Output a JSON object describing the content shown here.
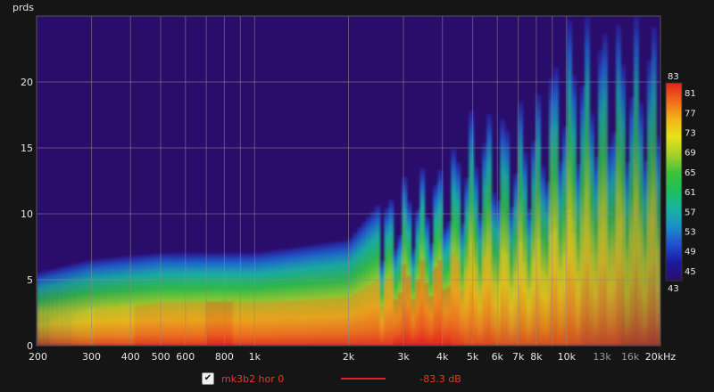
{
  "chart_data": {
    "type": "heatmap",
    "ylabel": "prds",
    "xlabel": "",
    "x_unit_label": "kHz",
    "x_scale": "log",
    "xlim": [
      200,
      20000
    ],
    "ylim": [
      0,
      25
    ],
    "x_ticks": [
      {
        "v": 200,
        "label": "200"
      },
      {
        "v": 300,
        "label": "300"
      },
      {
        "v": 400,
        "label": "400"
      },
      {
        "v": 500,
        "label": "500"
      },
      {
        "v": 600,
        "label": "600"
      },
      {
        "v": 800,
        "label": "800"
      },
      {
        "v": 1000,
        "label": "1k"
      },
      {
        "v": 2000,
        "label": "2k"
      },
      {
        "v": 3000,
        "label": "3k"
      },
      {
        "v": 4000,
        "label": "4k"
      },
      {
        "v": 5000,
        "label": "5k"
      },
      {
        "v": 6000,
        "label": "6k"
      },
      {
        "v": 7000,
        "label": "7k"
      },
      {
        "v": 8000,
        "label": "8k"
      },
      {
        "v": 10000,
        "label": "10k"
      },
      {
        "v": 13000,
        "label": "13k",
        "dim": true
      },
      {
        "v": 16000,
        "label": "16k",
        "dim": true
      },
      {
        "v": 20000,
        "label": "20kHz"
      }
    ],
    "x_gridlines": [
      200,
      300,
      400,
      500,
      600,
      700,
      800,
      900,
      1000,
      2000,
      3000,
      4000,
      5000,
      6000,
      7000,
      8000,
      9000,
      10000,
      20000
    ],
    "y_ticks": [
      0,
      5,
      10,
      15,
      20
    ],
    "colorbar": {
      "min": 43,
      "max": 83,
      "ticks": [
        83,
        81,
        77,
        73,
        69,
        65,
        61,
        57,
        53,
        49,
        45,
        43
      ],
      "stops": [
        "#2a0d6b",
        "#1c1a9e",
        "#1f4fd0",
        "#1d8fc8",
        "#19b2a2",
        "#1fbf5a",
        "#3dc23a",
        "#a6d12a",
        "#e6e21a",
        "#f3b21a",
        "#ef6a1c",
        "#e3231b"
      ]
    },
    "levels_by_frequency": [
      {
        "hz": 200,
        "level_db": 62,
        "extent_prds": 5.5
      },
      {
        "hz": 300,
        "level_db": 72,
        "extent_prds": 6.5
      },
      {
        "hz": 500,
        "level_db": 78,
        "extent_prds": 7
      },
      {
        "hz": 800,
        "level_db": 80,
        "extent_prds": 7
      },
      {
        "hz": 1000,
        "level_db": 78,
        "extent_prds": 7
      },
      {
        "hz": 2000,
        "level_db": 76,
        "extent_prds": 8
      },
      {
        "hz": 3000,
        "level_db": 80,
        "extent_prds": 13
      },
      {
        "hz": 4000,
        "level_db": 81,
        "extent_prds": 14
      },
      {
        "hz": 5000,
        "level_db": 74,
        "extent_prds": 18
      },
      {
        "hz": 6000,
        "level_db": 72,
        "extent_prds": 18
      },
      {
        "hz": 8000,
        "level_db": 71,
        "extent_prds": 19
      },
      {
        "hz": 10000,
        "level_db": 70,
        "extent_prds": 25
      },
      {
        "hz": 13000,
        "level_db": 66,
        "extent_prds": 25
      },
      {
        "hz": 16000,
        "level_db": 64,
        "extent_prds": 25
      },
      {
        "hz": 20000,
        "level_db": 60,
        "extent_prds": 25
      }
    ]
  },
  "legend": {
    "checked": true,
    "name": "mk3b2 hor 0",
    "value": "-83.3 dB",
    "color": "#e0231c"
  }
}
